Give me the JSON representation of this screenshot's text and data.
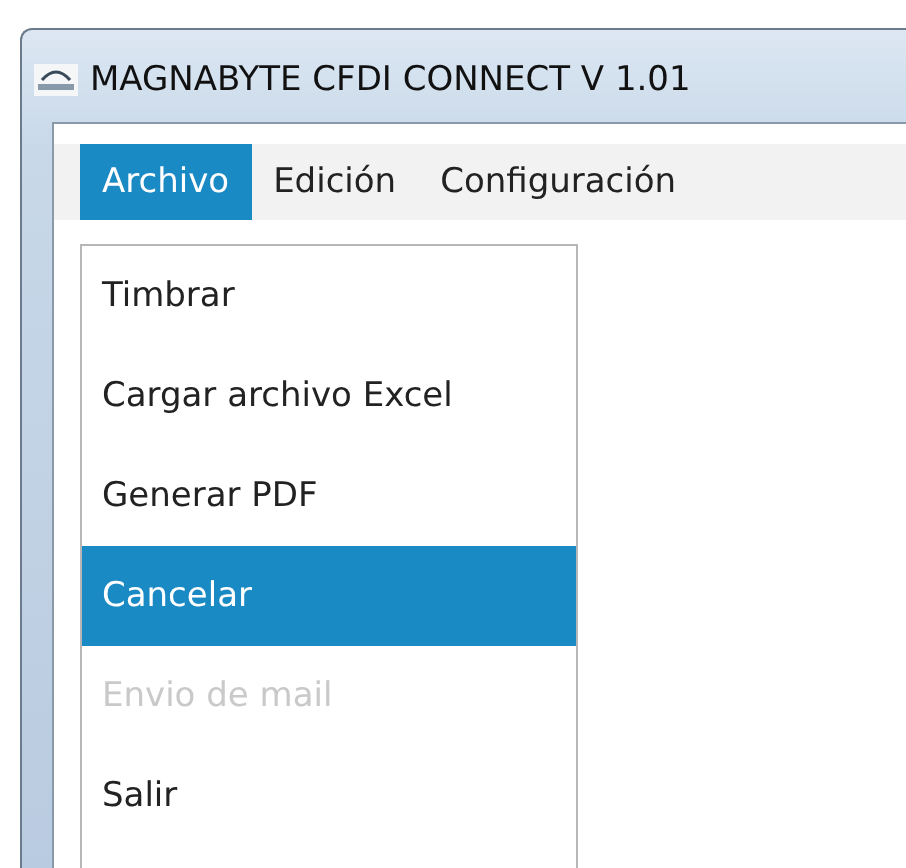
{
  "window": {
    "title": "MAGNABYTE CFDI CONNECT V 1.01"
  },
  "menu_bar": [
    {
      "label": "Archivo",
      "selected": true
    },
    {
      "label": "Edición",
      "selected": false
    },
    {
      "label": "Configuración",
      "selected": false
    }
  ],
  "dropdown": [
    {
      "label": "Timbrar",
      "selected": false,
      "disabled": false
    },
    {
      "label": "Cargar archivo Excel",
      "selected": false,
      "disabled": false
    },
    {
      "label": "Generar PDF",
      "selected": false,
      "disabled": false
    },
    {
      "label": "Cancelar",
      "selected": true,
      "disabled": false
    },
    {
      "label": "Envio de mail",
      "selected": false,
      "disabled": true
    },
    {
      "label": "Salir",
      "selected": false,
      "disabled": false
    }
  ]
}
